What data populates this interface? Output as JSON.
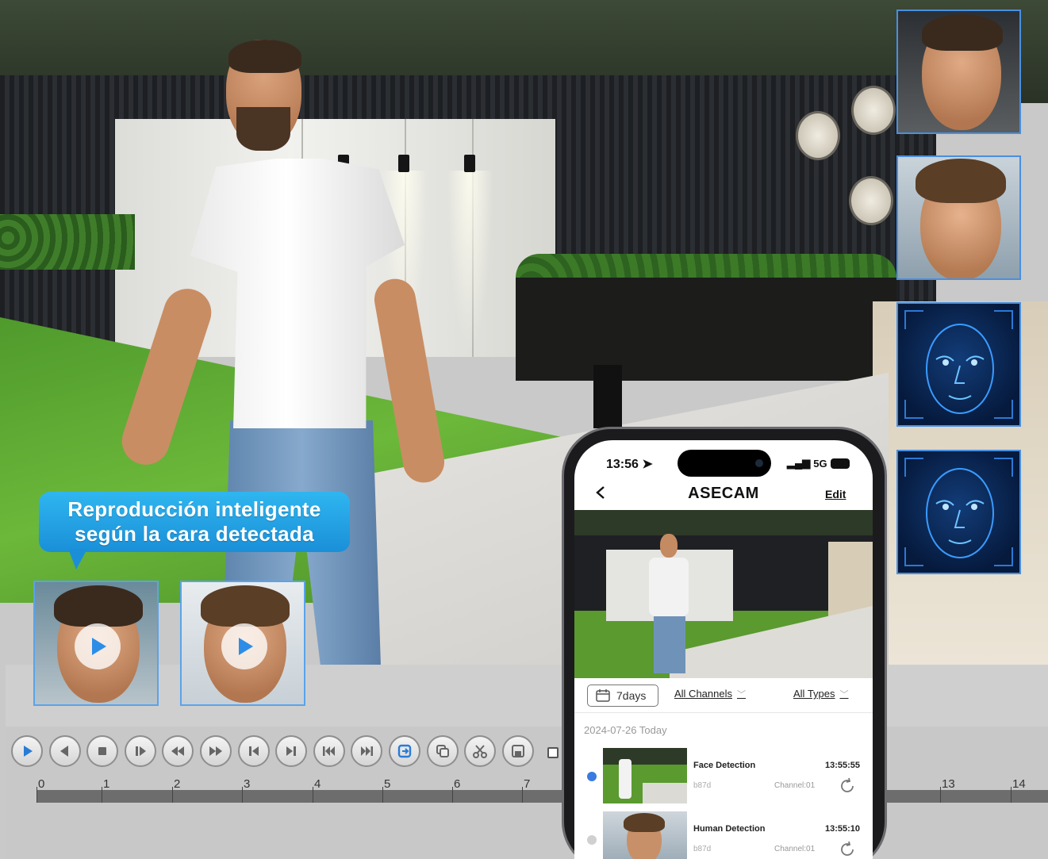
{
  "banner": {
    "line1": "Reproducción inteligente",
    "line2": "según la cara detectada"
  },
  "colors": {
    "accent": "#1a8fd8",
    "bubble_top": "#2fb6f0",
    "face_scan": "#2c78d4",
    "event_active": "#3a7be0",
    "event_inactive": "#d0d0d0"
  },
  "player": {
    "controls": [
      "play-icon",
      "prev-frame-icon",
      "stop-icon",
      "step-forward-icon",
      "rewind-icon",
      "fast-forward-icon",
      "skip-start-icon",
      "skip-end-icon",
      "first-file-icon",
      "last-file-icon",
      "sync-icon",
      "copy-icon",
      "cut-icon",
      "save-icon"
    ],
    "timeline_ticks": [
      "0",
      "1",
      "2",
      "3",
      "4",
      "5",
      "6",
      "7",
      "13",
      "14"
    ]
  },
  "phone": {
    "status": {
      "time": "13:56",
      "signal": "5G",
      "battery": ""
    },
    "nav": {
      "title": "ASECAM",
      "edit": "Edit"
    },
    "filters": {
      "days": "7days",
      "channels": "All Channels",
      "types": "All Types"
    },
    "date_header": "2024-07-26 Today",
    "events": [
      {
        "type": "Face Detection",
        "time": "13:55:55",
        "id": "b87d",
        "channel": "Channel:01",
        "active": true
      },
      {
        "type": "Human Detection",
        "time": "13:55:10",
        "id": "b87d",
        "channel": "Channel:01",
        "active": false
      }
    ]
  },
  "face_cards": [
    "face-photo-1",
    "face-photo-2",
    "face-scan-1",
    "face-scan-2"
  ]
}
